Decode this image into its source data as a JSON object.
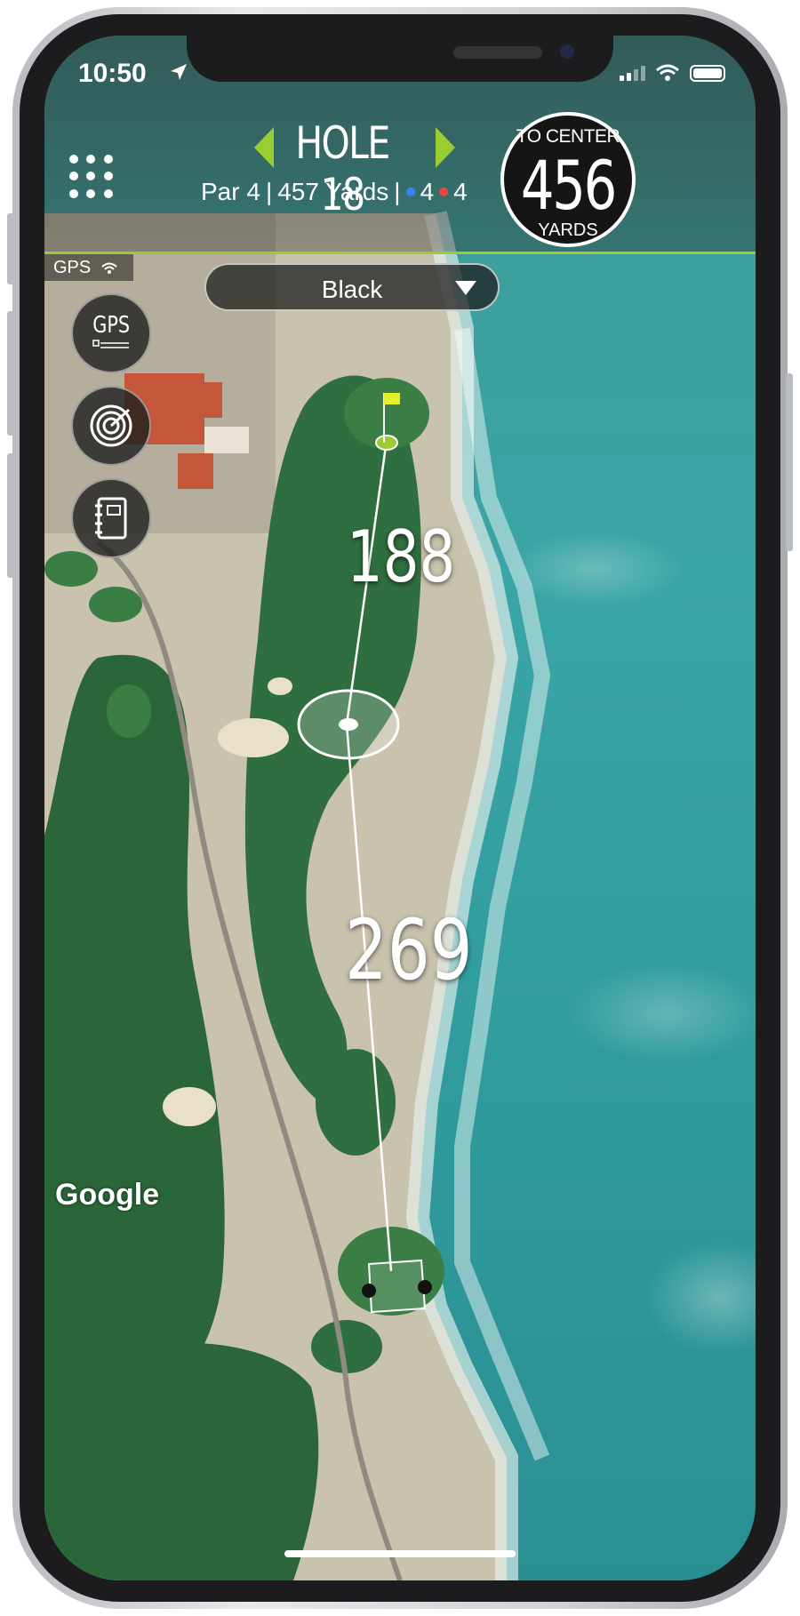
{
  "status_bar": {
    "time": "10:50"
  },
  "header": {
    "hole_title": "HOLE 18",
    "par": "Par 4",
    "yards": "457 Yards",
    "separator": "|",
    "blue_count": "4",
    "red_count": "4",
    "accent_color": "#9acd32"
  },
  "center_badge": {
    "top_label": "TO CENTER",
    "value": "456",
    "bottom_label": "YARDS"
  },
  "gps_tag": "GPS",
  "tee_select": {
    "selected": "Black"
  },
  "side_buttons": {
    "gps_label": "GPS",
    "icons": [
      "gps-icon",
      "target-icon",
      "scorecard-icon"
    ]
  },
  "distances": {
    "upper": "188",
    "lower": "269"
  },
  "map_attribution": "Google"
}
